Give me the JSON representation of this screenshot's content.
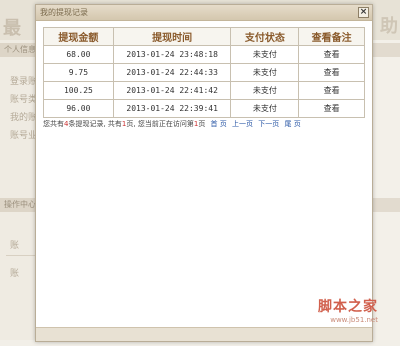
{
  "background": {
    "title": "最",
    "help": "助",
    "sidebar_section_1": "个人信息",
    "sidebar_links": [
      "登录账",
      "账号类",
      "我的账",
      "账号业"
    ],
    "sidebar_section_2": "操作中心",
    "sidebar_links_2": [
      "账",
      "账"
    ]
  },
  "modal": {
    "title": "我的提现记录",
    "close_label": "×"
  },
  "table": {
    "headers": [
      "提现金额",
      "提现时间",
      "支付状态",
      "查看备注"
    ],
    "rows": [
      {
        "amount": "68.00",
        "time": "2013-01-24 23:48:18",
        "status": "未支付",
        "view": "查看"
      },
      {
        "amount": "9.75",
        "time": "2013-01-24 22:44:33",
        "status": "未支付",
        "view": "查看"
      },
      {
        "amount": "100.25",
        "time": "2013-01-24 22:41:42",
        "status": "未支付",
        "view": "查看"
      },
      {
        "amount": "96.00",
        "time": "2013-01-24 22:39:41",
        "status": "未支付",
        "view": "查看"
      }
    ]
  },
  "pager": {
    "text_prefix": "您共有",
    "total_count": "4",
    "text_mid1": "条提现记录, 共有",
    "total_pages": "1",
    "text_mid2": "页, 您当前正在访问第",
    "current_page": "1",
    "text_suffix": "页",
    "first": "首 页",
    "prev": "上一页",
    "next": "下一页",
    "last": "尾 页"
  },
  "watermark": {
    "main": "脚本之家",
    "url": "www.jb51.net"
  }
}
